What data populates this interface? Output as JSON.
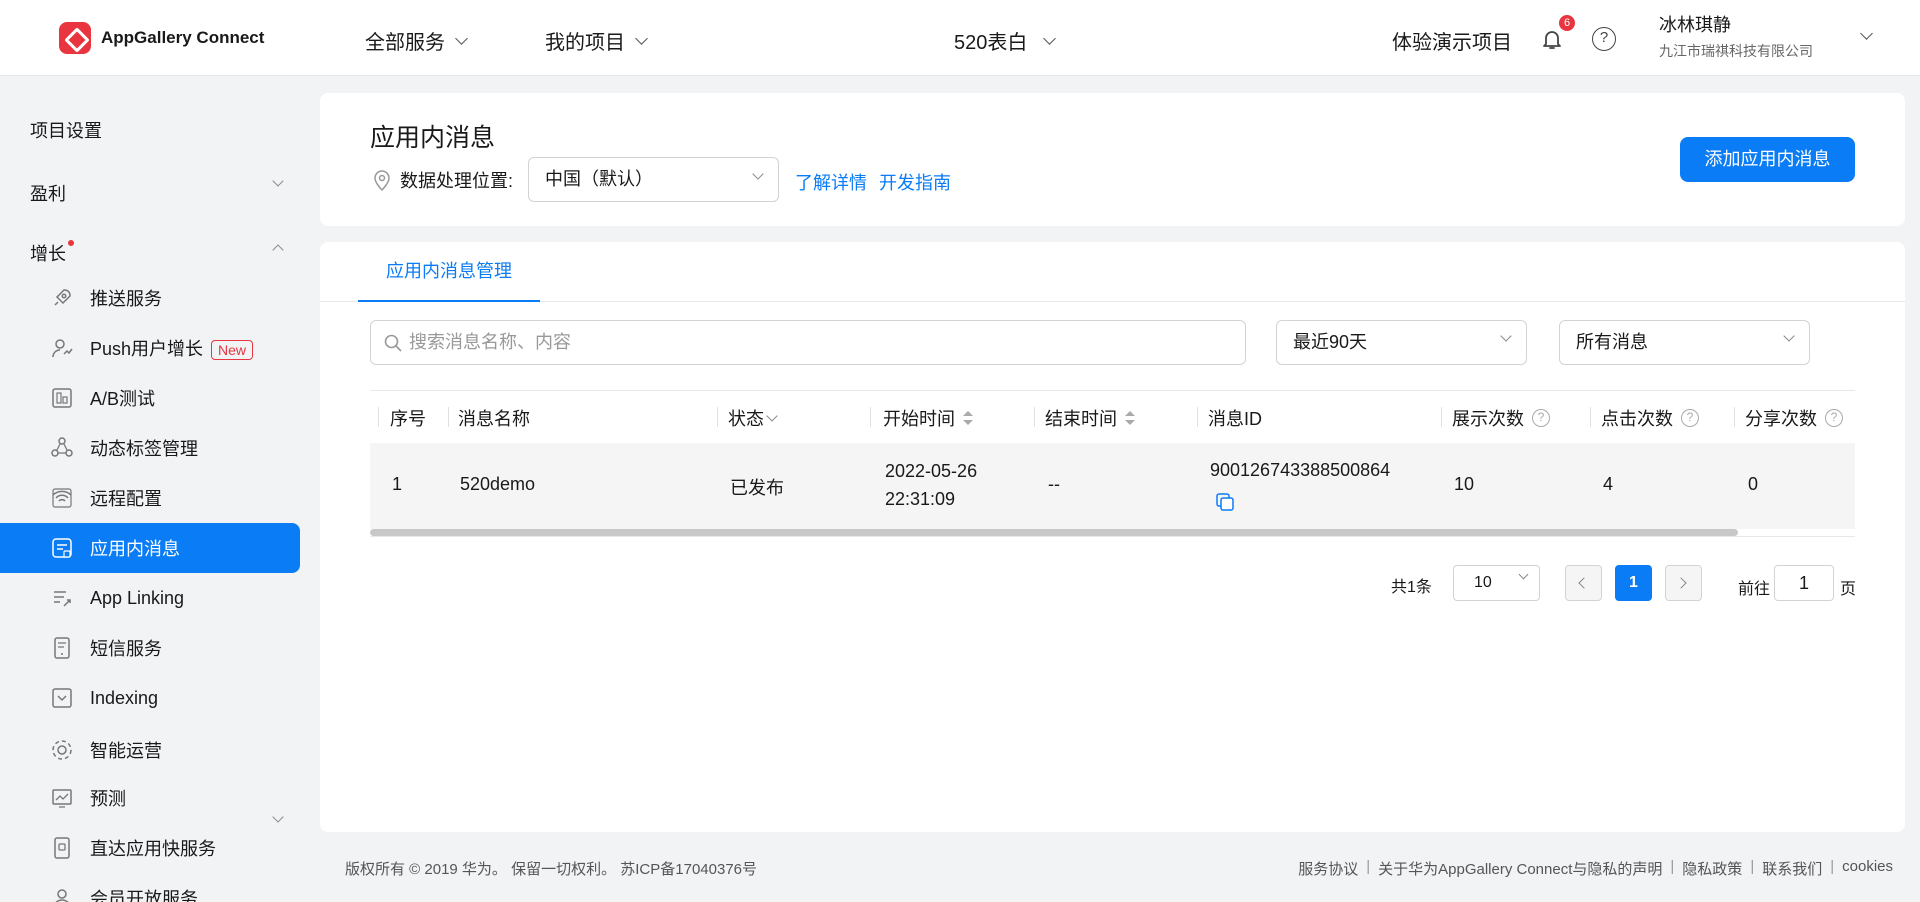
{
  "header": {
    "app_name": "AppGallery Connect",
    "nav": [
      "全部服务",
      "我的项目"
    ],
    "project": "520表白",
    "demo_project": "体验演示项目",
    "notification_count": "6",
    "help_glyph": "?",
    "user_name": "冰林琪静",
    "user_org": "九江市瑞祺科技有限公司"
  },
  "sidebar": {
    "top_items": [
      "项目设置",
      "盈利",
      "增长"
    ],
    "items": [
      {
        "label": "推送服务",
        "icon": "rocket-icon"
      },
      {
        "label": "Push用户增长",
        "icon": "user-growth-icon",
        "tag": "New"
      },
      {
        "label": "A/B测试",
        "icon": "ab-test-icon"
      },
      {
        "label": "动态标签管理",
        "icon": "tag-nodes-icon"
      },
      {
        "label": "远程配置",
        "icon": "remote-config-icon"
      },
      {
        "label": "应用内消息",
        "icon": "message-icon",
        "active": true
      },
      {
        "label": "App Linking",
        "icon": "link-icon"
      },
      {
        "label": "短信服务",
        "icon": "sms-icon"
      },
      {
        "label": "Indexing",
        "icon": "indexing-icon"
      },
      {
        "label": "智能运营",
        "icon": "smart-ops-icon"
      },
      {
        "label": "预测",
        "icon": "forecast-icon"
      },
      {
        "label": "直达应用快服务",
        "icon": "quick-service-icon"
      },
      {
        "label": "会员开放服务",
        "icon": "member-icon"
      }
    ]
  },
  "page": {
    "title": "应用内消息",
    "location_label": "数据处理位置:",
    "location_value": "中国（默认）",
    "link_details": "了解详情",
    "link_guide": "开发指南",
    "add_button": "添加应用内消息"
  },
  "tabs": [
    "应用内消息管理"
  ],
  "filters": {
    "search_placeholder": "搜索消息名称、内容",
    "date_range": "最近90天",
    "message_type": "所有消息"
  },
  "table": {
    "headers": [
      "序号",
      "消息名称",
      "状态",
      "开始时间",
      "结束时间",
      "消息ID",
      "展示次数",
      "点击次数",
      "分享次数"
    ],
    "rows": [
      {
        "index": "1",
        "name": "520demo",
        "status": "已发布",
        "start_date": "2022-05-26",
        "start_time": "22:31:09",
        "end": "--",
        "id": "900126743388500864",
        "views": "10",
        "clicks": "4",
        "shares": "0"
      }
    ]
  },
  "pagination": {
    "total": "共1条",
    "page_size": "10",
    "current": "1",
    "goto_prefix": "前往",
    "goto_value": "1",
    "goto_suffix": "页"
  },
  "footer": {
    "copyright": "版权所有 © 2019 华为。 保留一切权利。 苏ICP备17040376号",
    "links": [
      "服务协议",
      "关于华为AppGallery Connect与隐私的声明",
      "隐私政策",
      "联系我们",
      "cookies"
    ]
  },
  "colors": {
    "accent": "#0a7cf5",
    "brand_red": "#e8353f"
  }
}
